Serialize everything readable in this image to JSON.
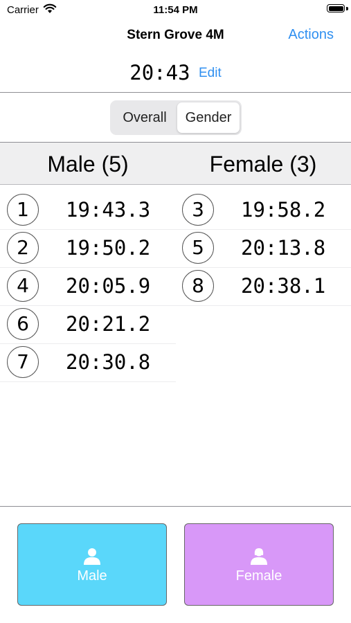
{
  "status_bar": {
    "carrier": "Carrier",
    "time": "11:54 PM"
  },
  "nav": {
    "title": "Stern Grove 4M",
    "actions_label": "Actions"
  },
  "timer": {
    "value": "20:43",
    "edit_label": "Edit"
  },
  "segments": {
    "overall": "Overall",
    "gender": "Gender",
    "selected": "gender"
  },
  "columns": {
    "male_header": "Male (5)",
    "female_header": "Female (3)"
  },
  "male_results": [
    {
      "place": "1",
      "time": "19:43.3"
    },
    {
      "place": "2",
      "time": "19:50.2"
    },
    {
      "place": "4",
      "time": "20:05.9"
    },
    {
      "place": "6",
      "time": "20:21.2"
    },
    {
      "place": "7",
      "time": "20:30.8"
    }
  ],
  "female_results": [
    {
      "place": "3",
      "time": "19:58.2"
    },
    {
      "place": "5",
      "time": "20:13.8"
    },
    {
      "place": "8",
      "time": "20:38.1"
    }
  ],
  "buttons": {
    "male_label": "Male",
    "female_label": "Female",
    "male_color": "#5ad7fa",
    "female_color": "#d898f8",
    "icon": "person-icon"
  },
  "colors": {
    "accent": "#2f8ff0"
  }
}
